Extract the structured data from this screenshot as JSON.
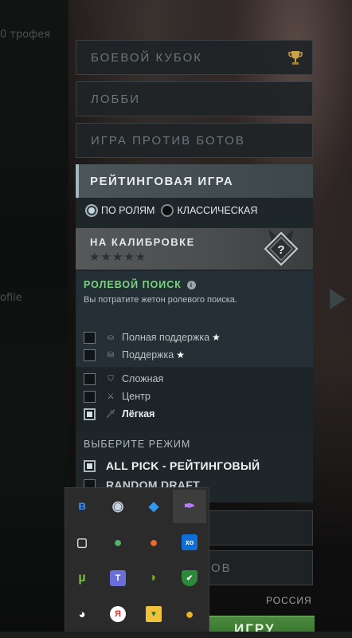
{
  "background": {
    "left_text_top": "0 трофея",
    "left_text_mid": "ofile"
  },
  "menu": {
    "battle_cup": "БОЕВОЙ КУБОК",
    "lobby": "ЛОББИ",
    "bots": "ИГРА ПРОТИВ БОТОВ"
  },
  "ranked": {
    "title": "РЕЙТИНГОВАЯ ИГРА",
    "mode_roles": "ПО РОЛЯМ",
    "mode_classic": "КЛАССИЧЕСКАЯ",
    "calibration_title": "НА КАЛИБРОВКЕ",
    "stars": "★★★★★",
    "rank_symbol": "?"
  },
  "role_search": {
    "title": "РОЛЕВОЙ ПОИСК",
    "info": "i",
    "description": "Вы потратите жетон ролевого поиска.",
    "roles": [
      {
        "label": "Полная поддержка",
        "star": "★",
        "checked": false
      },
      {
        "label": "Поддержка",
        "star": "★",
        "checked": false
      },
      {
        "label": "Сложная",
        "star": "",
        "checked": false
      },
      {
        "label": "Центр",
        "star": "",
        "checked": false
      },
      {
        "label": "Лёгкая",
        "star": "",
        "checked": true
      }
    ]
  },
  "game_mode": {
    "header": "ВЫБЕРИТЕ РЕЖИМ",
    "options": [
      {
        "label": "ALL PICK - РЕЙТИНГОВЫЙ",
        "checked": true
      },
      {
        "label": "RANDOM DRAFT",
        "checked": false
      }
    ]
  },
  "lower": {
    "partial_button_text": "ОВ",
    "region": "РОССИЯ",
    "play_button": "ИГРУ"
  },
  "tray": {
    "icons": [
      {
        "name": "bluetooth",
        "glyph": "ʙ",
        "color": "#2f8cff"
      },
      {
        "name": "steam",
        "glyph": "◉",
        "color": "#c7d5e0"
      },
      {
        "name": "malwarebytes",
        "glyph": "◆",
        "color": "#2e9bf0"
      },
      {
        "name": "feather",
        "glyph": "✒",
        "color": "#b77cff"
      },
      {
        "name": "meet-now",
        "glyph": "▢",
        "color": "#d8d8d8"
      },
      {
        "name": "globe",
        "glyph": "●",
        "color": "#4fb46a"
      },
      {
        "name": "people-app",
        "glyph": "●",
        "color": "#ef6b2a"
      },
      {
        "name": "xo-app",
        "glyph": "xo",
        "color": "#0f6fd8"
      },
      {
        "name": "utorrent",
        "glyph": "µ",
        "color": "#77c043"
      },
      {
        "name": "teams",
        "glyph": "T",
        "color": "#6a6fd8"
      },
      {
        "name": "nvidia",
        "glyph": "◗",
        "color": "#76b900"
      },
      {
        "name": "defender-shield",
        "glyph": "✔",
        "color": "#ffffff"
      },
      {
        "name": "discord",
        "glyph": "◕",
        "color": "#ffffff"
      },
      {
        "name": "yandex",
        "glyph": "Я",
        "color": "#e5322d"
      },
      {
        "name": "folder-sync",
        "glyph": "▼",
        "color": "#f0c23c"
      },
      {
        "name": "driver-app",
        "glyph": "●",
        "color": "#e8b42a"
      }
    ]
  },
  "colors": {
    "role_title": "#79d37e",
    "play_button": "#3f7f33",
    "accent_bar": "#9fb8c0"
  }
}
